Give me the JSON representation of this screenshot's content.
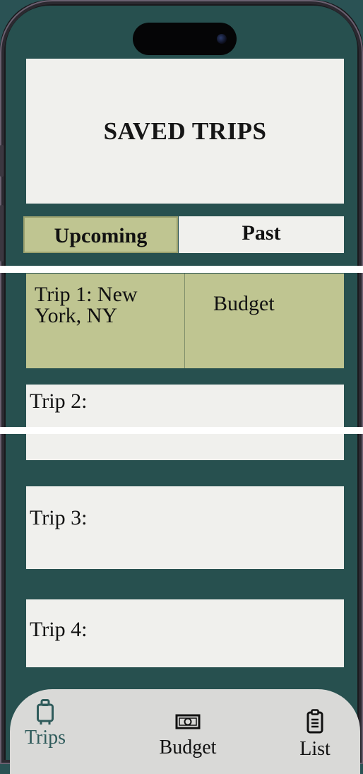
{
  "header": {
    "title": "SAVED TRIPS"
  },
  "tabs": {
    "upcoming": "Upcoming",
    "past": "Past"
  },
  "trips": [
    {
      "label": "Trip 1: New York, NY",
      "line1": "Trip 1: New",
      "line2": "York, NY",
      "budget_label": "Budget"
    },
    {
      "label": "Trip 2:"
    },
    {
      "label": "Trip 3:"
    },
    {
      "label": "Trip 4:"
    }
  ],
  "nav": {
    "items": [
      {
        "label": "Trips",
        "icon": "luggage-icon",
        "active": true
      },
      {
        "label": "Budget",
        "icon": "money-icon",
        "active": false
      },
      {
        "label": "List",
        "icon": "clipboard-icon",
        "active": false
      }
    ]
  },
  "colors": {
    "background": "#27504f",
    "card": "#f0f0ed",
    "accent": "#bfc591",
    "active_nav": "#2f5b5b"
  }
}
